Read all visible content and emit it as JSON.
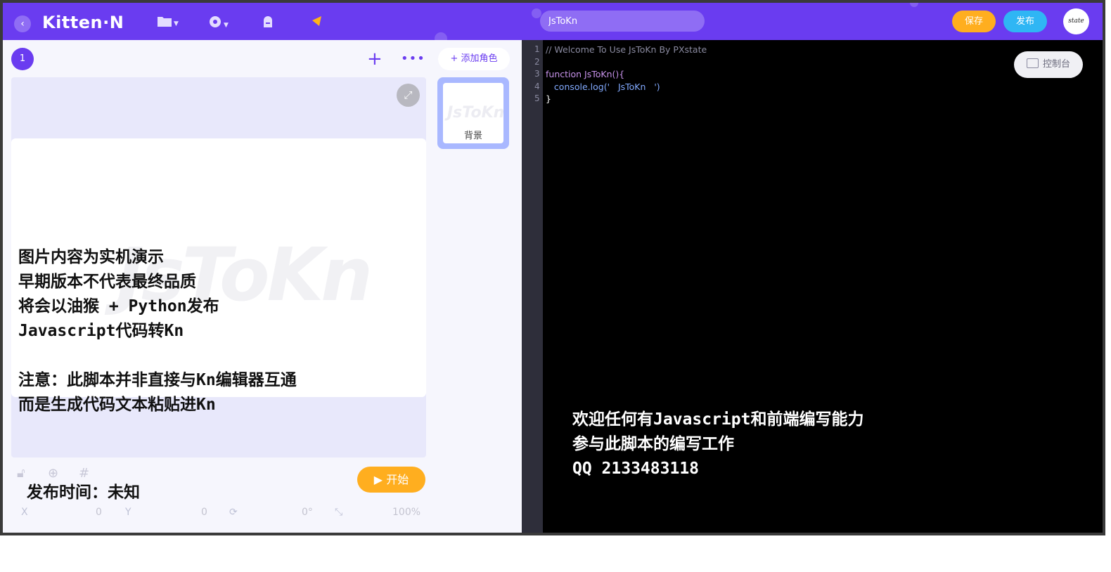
{
  "app": {
    "logo": "Kitten·N",
    "back_glyph": "‹"
  },
  "toolbar": {
    "icons": [
      "folder-icon",
      "gear-icon",
      "bag-icon",
      "pointer-icon"
    ],
    "search_value": "JsToKn",
    "save_label": "保存",
    "publish_label": "发布",
    "avatar_text": "state"
  },
  "stage_panel": {
    "scene_number": "1",
    "plus_glyph": "+",
    "more_glyph": "•••",
    "add_role_label": "+ 添加角色",
    "watermark": "JsToKn",
    "intro_lines": [
      "图片内容为实机演示",
      "早期版本不代表最终品质",
      "将会以油猴 + Python发布",
      "Javascript代码转Kn"
    ],
    "note_lines": [
      "注意：此脚本并非直接与Kn编辑器互通",
      "而是生成代码文本粘贴进Kn"
    ],
    "release_text": "发布时间：未知",
    "start_label": "开始",
    "props": {
      "x_label": "X",
      "x_value": "0",
      "y_label": "Y",
      "y_value": "0",
      "rotation": "0°",
      "scale": "100%"
    }
  },
  "role_card": {
    "watermark": "JsToKn",
    "label": "背景"
  },
  "editor": {
    "line_numbers": [
      "1",
      "2",
      "3",
      "4",
      "5"
    ],
    "lines": [
      {
        "text": "// Welcome To Use JsToKn By PXstate",
        "color": "#8a8aa0"
      },
      {
        "text": "",
        "color": "#ffffff"
      },
      {
        "text": "function JsToKn(){",
        "color": "#c792ea"
      },
      {
        "text": "   console.log('   JsToKn   ')",
        "color": "#82aaff"
      },
      {
        "text": "}",
        "color": "#ffffff"
      }
    ],
    "console_label": "控制台",
    "invite_lines": [
      "欢迎任何有Javascript和前端编写能力",
      "参与此脚本的编写工作",
      "QQ 2133483118"
    ]
  },
  "colors": {
    "brand": "#6a3cf0",
    "save": "#ffae1f",
    "publish": "#2fb6f4",
    "start": "#ffae1f"
  }
}
